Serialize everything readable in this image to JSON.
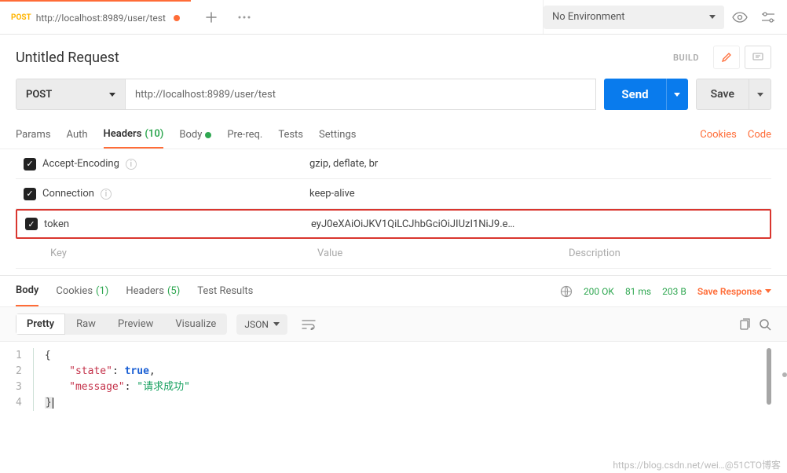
{
  "tab": {
    "method": "POST",
    "title": "http://localhost:8989/user/test"
  },
  "env": {
    "selected": "No Environment"
  },
  "request": {
    "title": "Untitled Request",
    "build_label": "BUILD"
  },
  "methodSelect": "POST",
  "url": "http://localhost:8989/user/test",
  "sendLabel": "Send",
  "saveLabel": "Save",
  "reqTabs": {
    "params": "Params",
    "auth": "Auth",
    "headers": "Headers",
    "headers_count": "(10)",
    "body": "Body",
    "prereq": "Pre-req.",
    "tests": "Tests",
    "settings": "Settings",
    "cookies_link": "Cookies",
    "code_link": "Code"
  },
  "headers": {
    "rows": [
      {
        "key": "Accept-Encoding",
        "value": "gzip, deflate, br",
        "info": true
      },
      {
        "key": "Connection",
        "value": "keep-alive",
        "info": true
      },
      {
        "key": "token",
        "value": "eyJ0eXAiOiJKV1QiLCJhbGciOiJIUzI1NiJ9.e…",
        "highlight": true
      }
    ],
    "placeholder": {
      "key": "Key",
      "value": "Value",
      "description": "Description"
    }
  },
  "respTabs": {
    "body": "Body",
    "cookies": "Cookies",
    "cookies_count": "(1)",
    "headers": "Headers",
    "headers_count": "(5)",
    "tests": "Test Results"
  },
  "respStatus": {
    "status": "200 OK",
    "time": "81 ms",
    "size": "203 B",
    "save_response": "Save Response"
  },
  "viewModes": {
    "pretty": "Pretty",
    "raw": "Raw",
    "preview": "Preview",
    "visualize": "Visualize",
    "lang": "JSON"
  },
  "responseBody": {
    "line1": "{",
    "k_state": "\"state\"",
    "v_state": "true",
    "k_message": "\"message\"",
    "v_message": "\"请求成功\"",
    "line4": "}"
  },
  "watermark": "https://blog.csdn.net/wei…@51CTO博客"
}
